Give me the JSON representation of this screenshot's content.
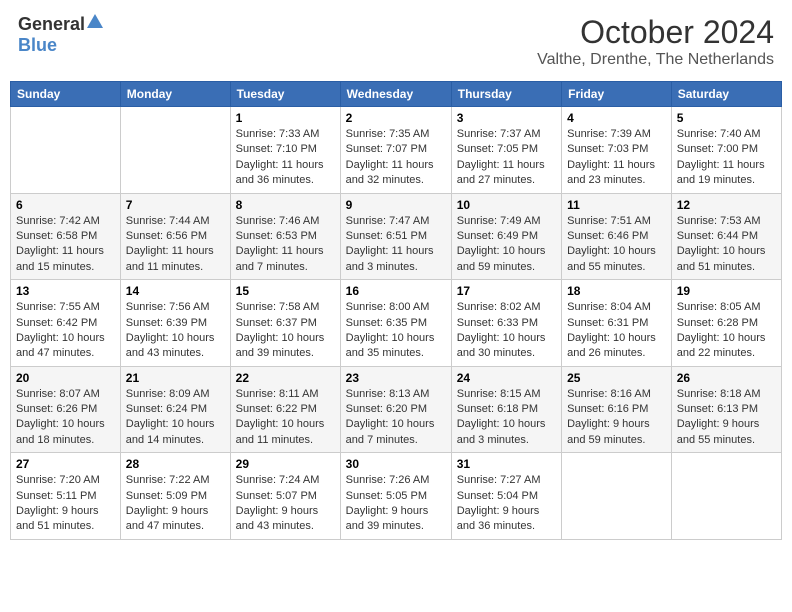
{
  "logo": {
    "general": "General",
    "blue": "Blue"
  },
  "header": {
    "month": "October 2024",
    "location": "Valthe, Drenthe, The Netherlands"
  },
  "weekdays": [
    "Sunday",
    "Monday",
    "Tuesday",
    "Wednesday",
    "Thursday",
    "Friday",
    "Saturday"
  ],
  "weeks": [
    [
      {
        "day": "",
        "info": ""
      },
      {
        "day": "",
        "info": ""
      },
      {
        "day": "1",
        "info": "Sunrise: 7:33 AM\nSunset: 7:10 PM\nDaylight: 11 hours and 36 minutes."
      },
      {
        "day": "2",
        "info": "Sunrise: 7:35 AM\nSunset: 7:07 PM\nDaylight: 11 hours and 32 minutes."
      },
      {
        "day": "3",
        "info": "Sunrise: 7:37 AM\nSunset: 7:05 PM\nDaylight: 11 hours and 27 minutes."
      },
      {
        "day": "4",
        "info": "Sunrise: 7:39 AM\nSunset: 7:03 PM\nDaylight: 11 hours and 23 minutes."
      },
      {
        "day": "5",
        "info": "Sunrise: 7:40 AM\nSunset: 7:00 PM\nDaylight: 11 hours and 19 minutes."
      }
    ],
    [
      {
        "day": "6",
        "info": "Sunrise: 7:42 AM\nSunset: 6:58 PM\nDaylight: 11 hours and 15 minutes."
      },
      {
        "day": "7",
        "info": "Sunrise: 7:44 AM\nSunset: 6:56 PM\nDaylight: 11 hours and 11 minutes."
      },
      {
        "day": "8",
        "info": "Sunrise: 7:46 AM\nSunset: 6:53 PM\nDaylight: 11 hours and 7 minutes."
      },
      {
        "day": "9",
        "info": "Sunrise: 7:47 AM\nSunset: 6:51 PM\nDaylight: 11 hours and 3 minutes."
      },
      {
        "day": "10",
        "info": "Sunrise: 7:49 AM\nSunset: 6:49 PM\nDaylight: 10 hours and 59 minutes."
      },
      {
        "day": "11",
        "info": "Sunrise: 7:51 AM\nSunset: 6:46 PM\nDaylight: 10 hours and 55 minutes."
      },
      {
        "day": "12",
        "info": "Sunrise: 7:53 AM\nSunset: 6:44 PM\nDaylight: 10 hours and 51 minutes."
      }
    ],
    [
      {
        "day": "13",
        "info": "Sunrise: 7:55 AM\nSunset: 6:42 PM\nDaylight: 10 hours and 47 minutes."
      },
      {
        "day": "14",
        "info": "Sunrise: 7:56 AM\nSunset: 6:39 PM\nDaylight: 10 hours and 43 minutes."
      },
      {
        "day": "15",
        "info": "Sunrise: 7:58 AM\nSunset: 6:37 PM\nDaylight: 10 hours and 39 minutes."
      },
      {
        "day": "16",
        "info": "Sunrise: 8:00 AM\nSunset: 6:35 PM\nDaylight: 10 hours and 35 minutes."
      },
      {
        "day": "17",
        "info": "Sunrise: 8:02 AM\nSunset: 6:33 PM\nDaylight: 10 hours and 30 minutes."
      },
      {
        "day": "18",
        "info": "Sunrise: 8:04 AM\nSunset: 6:31 PM\nDaylight: 10 hours and 26 minutes."
      },
      {
        "day": "19",
        "info": "Sunrise: 8:05 AM\nSunset: 6:28 PM\nDaylight: 10 hours and 22 minutes."
      }
    ],
    [
      {
        "day": "20",
        "info": "Sunrise: 8:07 AM\nSunset: 6:26 PM\nDaylight: 10 hours and 18 minutes."
      },
      {
        "day": "21",
        "info": "Sunrise: 8:09 AM\nSunset: 6:24 PM\nDaylight: 10 hours and 14 minutes."
      },
      {
        "day": "22",
        "info": "Sunrise: 8:11 AM\nSunset: 6:22 PM\nDaylight: 10 hours and 11 minutes."
      },
      {
        "day": "23",
        "info": "Sunrise: 8:13 AM\nSunset: 6:20 PM\nDaylight: 10 hours and 7 minutes."
      },
      {
        "day": "24",
        "info": "Sunrise: 8:15 AM\nSunset: 6:18 PM\nDaylight: 10 hours and 3 minutes."
      },
      {
        "day": "25",
        "info": "Sunrise: 8:16 AM\nSunset: 6:16 PM\nDaylight: 9 hours and 59 minutes."
      },
      {
        "day": "26",
        "info": "Sunrise: 8:18 AM\nSunset: 6:13 PM\nDaylight: 9 hours and 55 minutes."
      }
    ],
    [
      {
        "day": "27",
        "info": "Sunrise: 7:20 AM\nSunset: 5:11 PM\nDaylight: 9 hours and 51 minutes."
      },
      {
        "day": "28",
        "info": "Sunrise: 7:22 AM\nSunset: 5:09 PM\nDaylight: 9 hours and 47 minutes."
      },
      {
        "day": "29",
        "info": "Sunrise: 7:24 AM\nSunset: 5:07 PM\nDaylight: 9 hours and 43 minutes."
      },
      {
        "day": "30",
        "info": "Sunrise: 7:26 AM\nSunset: 5:05 PM\nDaylight: 9 hours and 39 minutes."
      },
      {
        "day": "31",
        "info": "Sunrise: 7:27 AM\nSunset: 5:04 PM\nDaylight: 9 hours and 36 minutes."
      },
      {
        "day": "",
        "info": ""
      },
      {
        "day": "",
        "info": ""
      }
    ]
  ]
}
